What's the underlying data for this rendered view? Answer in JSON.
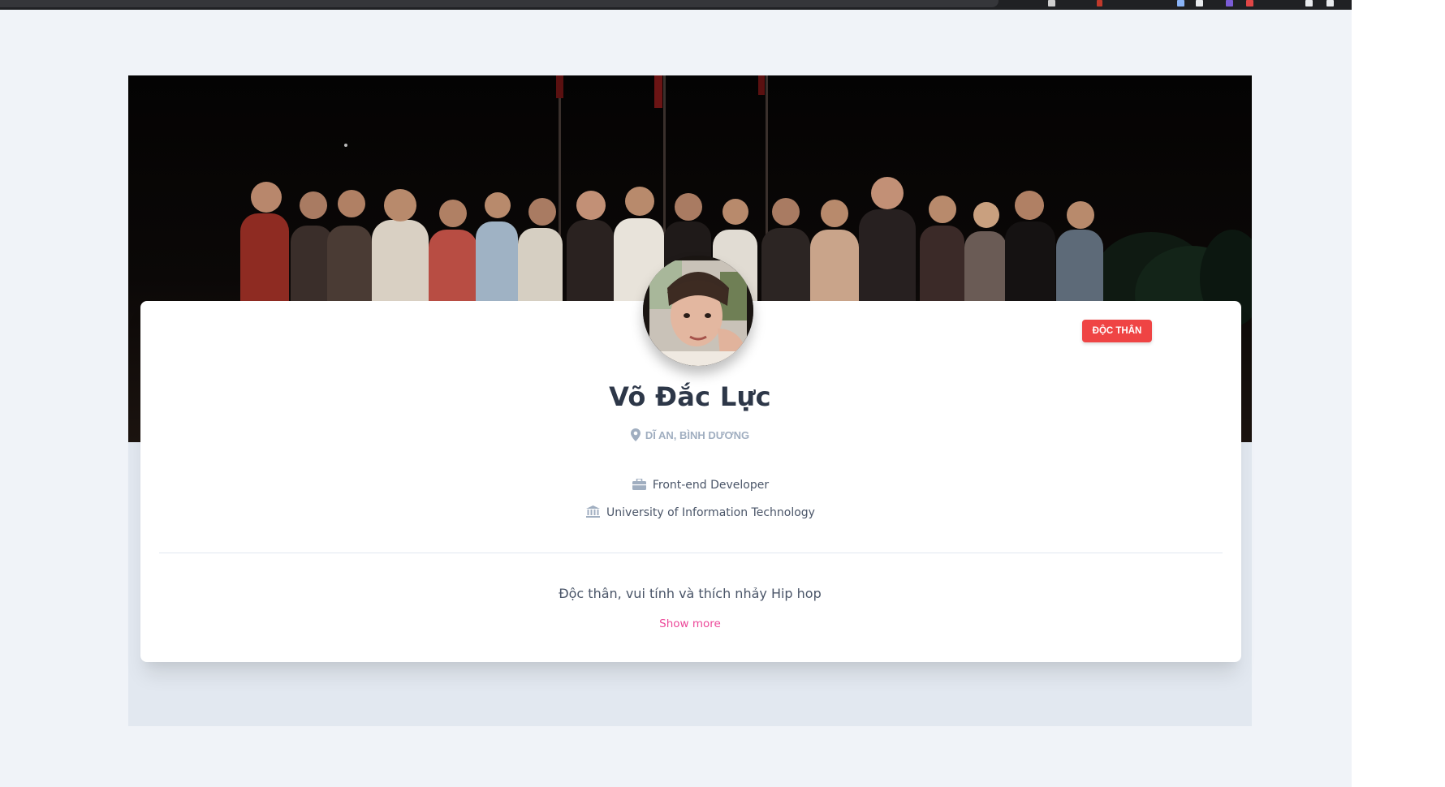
{
  "profile": {
    "name": "Võ Đắc Lực",
    "location": "DĨ AN, BÌNH DƯƠNG",
    "job": "Front-end Developer",
    "school": "University of Information Technology",
    "bio": "Độc thân, vui tính và thích nhảy Hip hop",
    "show_more_label": "Show more",
    "status_badge": "ĐỘC THÂN"
  },
  "icons": {
    "location": "map-marker-icon",
    "job": "briefcase-icon",
    "school": "university-icon"
  },
  "colors": {
    "page_background": "#f0f3f8",
    "section_background": "#e2e8f0",
    "card_background": "#ffffff",
    "badge": "#ef4444",
    "name": "#2d3748",
    "muted": "#a0aec0",
    "text": "#4a5568",
    "link": "#ec4899"
  }
}
